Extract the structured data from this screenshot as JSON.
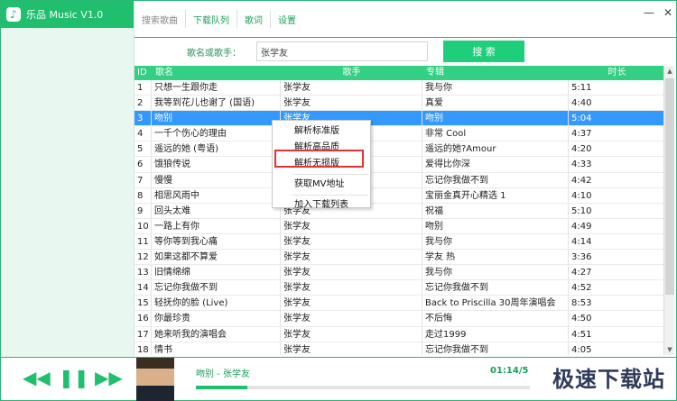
{
  "app": {
    "title": "乐品 Music V1.0"
  },
  "tabs": [
    {
      "label": "搜索歌曲"
    },
    {
      "label": "下载队列"
    },
    {
      "label": "歌词"
    },
    {
      "label": "设置"
    }
  ],
  "window": {
    "minimize": "—",
    "close": "✕"
  },
  "search": {
    "label": "歌名或歌手：",
    "value": "张学友",
    "button": "搜 索"
  },
  "table": {
    "headers": {
      "id": "ID",
      "song": "歌名",
      "artist": "歌手",
      "album": "专辑",
      "duration": "时长"
    },
    "rows": [
      {
        "id": "1",
        "song": "只想一生跟你走",
        "artist": "张学友",
        "album": "我与你",
        "duration": "5:11"
      },
      {
        "id": "2",
        "song": "我等到花儿也谢了 (国语)",
        "artist": "张学友",
        "album": "真爱",
        "duration": "4:40"
      },
      {
        "id": "3",
        "song": "吻别",
        "artist": "张学友",
        "album": "吻别",
        "duration": "5:04"
      },
      {
        "id": "4",
        "song": "一千个伤心的理由",
        "artist": "",
        "album": "非常 Cool",
        "duration": "4:37"
      },
      {
        "id": "5",
        "song": "遥远的她 (粤语)",
        "artist": "",
        "album": "遥远的她?Amour",
        "duration": "4:20"
      },
      {
        "id": "6",
        "song": "饿狼传说",
        "artist": "",
        "album": "爱得比你深",
        "duration": "4:33"
      },
      {
        "id": "7",
        "song": "慢慢",
        "artist": "",
        "album": "忘记你我做不到",
        "duration": "4:42"
      },
      {
        "id": "8",
        "song": "相思风雨中",
        "artist": "",
        "album": "宝丽金真开心精选 1",
        "duration": "4:10"
      },
      {
        "id": "9",
        "song": "回头太难",
        "artist": "张学友",
        "album": "祝福",
        "duration": "5:10"
      },
      {
        "id": "10",
        "song": "一路上有你",
        "artist": "张学友",
        "album": "吻别",
        "duration": "4:49"
      },
      {
        "id": "11",
        "song": "等你等到我心痛",
        "artist": "张学友",
        "album": "我与你",
        "duration": "4:14"
      },
      {
        "id": "12",
        "song": "如果这都不算爱",
        "artist": "张学友",
        "album": "学友 热",
        "duration": "3:36"
      },
      {
        "id": "13",
        "song": "旧情绵绵",
        "artist": "张学友",
        "album": "我与你",
        "duration": "4:27"
      },
      {
        "id": "14",
        "song": "忘记你我做不到",
        "artist": "张学友",
        "album": "忘记你我做不到",
        "duration": "4:52"
      },
      {
        "id": "15",
        "song": "轻抚你的脸 (Live)",
        "artist": "张学友",
        "album": "Back to Priscilla 30周年演唱会",
        "duration": "8:53"
      },
      {
        "id": "16",
        "song": "你最珍贵",
        "artist": "张学友",
        "album": "不后悔",
        "duration": "4:50"
      },
      {
        "id": "17",
        "song": "她来听我的演唱会",
        "artist": "张学友",
        "album": "走过1999",
        "duration": "4:51"
      },
      {
        "id": "18",
        "song": "情书",
        "artist": "张学友",
        "album": "忘记你我做不到",
        "duration": "4:05"
      }
    ]
  },
  "context_menu": {
    "items": [
      {
        "label": "解析标准版"
      },
      {
        "label": "解析高品质"
      },
      {
        "label": "解析无损版"
      },
      {
        "label": "获取MV地址"
      },
      {
        "label": "加入下载列表"
      }
    ]
  },
  "player": {
    "now_playing": "吻别 - 张学友",
    "time": "01:14/5",
    "progress_fraction": 0.154
  },
  "watermark": "极速下载站",
  "colors": {
    "accent": "#1fbf6e",
    "selection": "#3399ff",
    "header": "#33cf83",
    "highlight": "#e03333"
  }
}
